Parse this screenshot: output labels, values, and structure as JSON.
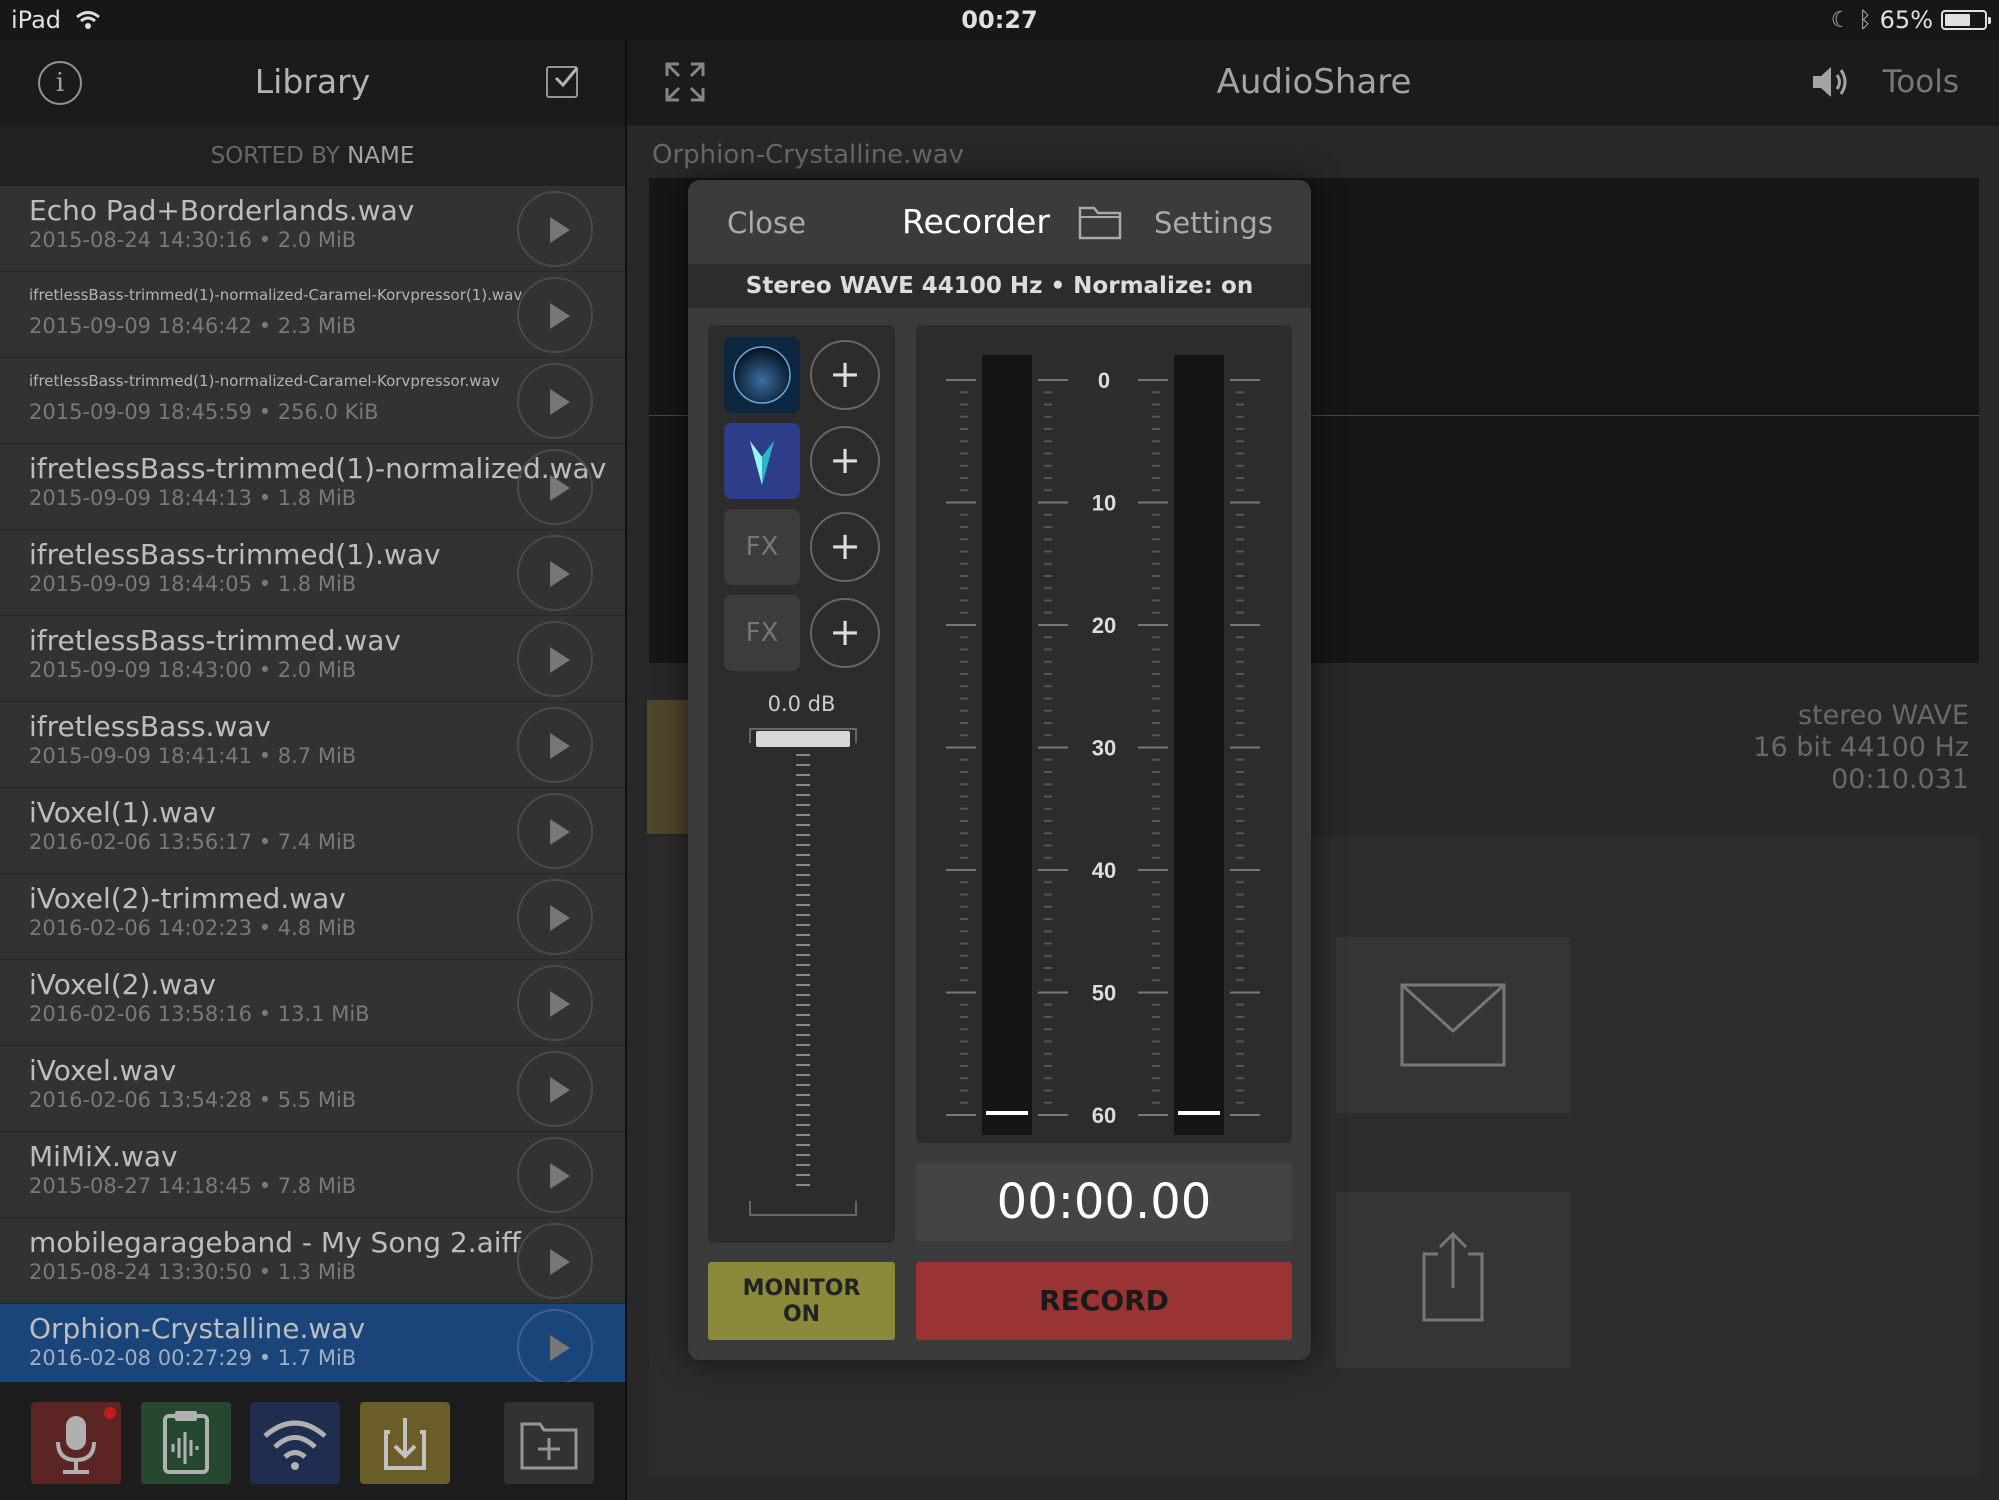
{
  "status": {
    "device": "iPad",
    "time": "00:27",
    "battery": "65%"
  },
  "library": {
    "title": "Library",
    "sort_prefix": "SORTED BY",
    "sort_key": "NAME",
    "files": [
      {
        "name": "Echo Pad+Borderlands.wav",
        "meta": "2015-08-24 14:30:16 • 2.0 MiB"
      },
      {
        "name": "ifretlessBass-trimmed(1)-normalized-Caramel-Korvpressor(1).wav",
        "meta": "2015-09-09 18:46:42 • 2.3 MiB"
      },
      {
        "name": "ifretlessBass-trimmed(1)-normalized-Caramel-Korvpressor.wav",
        "meta": "2015-09-09 18:45:59 • 256.0 KiB"
      },
      {
        "name": "ifretlessBass-trimmed(1)-normalized.wav",
        "meta": "2015-09-09 18:44:13 • 1.8 MiB"
      },
      {
        "name": "ifretlessBass-trimmed(1).wav",
        "meta": "2015-09-09 18:44:05 • 1.8 MiB"
      },
      {
        "name": "ifretlessBass-trimmed.wav",
        "meta": "2015-09-09 18:43:00 • 2.0 MiB"
      },
      {
        "name": "ifretlessBass.wav",
        "meta": "2015-09-09 18:41:41 • 8.7 MiB"
      },
      {
        "name": "iVoxel(1).wav",
        "meta": "2016-02-06 13:56:17 • 7.4 MiB"
      },
      {
        "name": "iVoxel(2)-trimmed.wav",
        "meta": "2016-02-06 14:02:23 • 4.8 MiB"
      },
      {
        "name": "iVoxel(2).wav",
        "meta": "2016-02-06 13:58:16 • 13.1 MiB"
      },
      {
        "name": "iVoxel.wav",
        "meta": "2016-02-06 13:54:28 • 5.5 MiB"
      },
      {
        "name": "MiMiX.wav",
        "meta": "2015-08-27 14:18:45 • 7.8 MiB"
      },
      {
        "name": "mobilegarageband - My Song 2.aiff",
        "meta": "2015-08-24 13:30:50 • 1.3 MiB"
      },
      {
        "name": "Orphion-Crystalline.wav",
        "meta": "2016-02-08 00:27:29 • 1.7 MiB"
      }
    ],
    "footer_icons": [
      "microphone-icon",
      "clipboard-waveform-icon",
      "wifi-icon",
      "download-icon",
      "new-folder-icon"
    ]
  },
  "main": {
    "title": "AudioShare",
    "tools_label": "Tools",
    "current_file": "Orphion-Crystalline.wav",
    "file_info": [
      "stereo WAVE",
      "16 bit 44100 Hz",
      "00:10.031"
    ]
  },
  "recorder": {
    "close_label": "Close",
    "title": "Recorder",
    "settings_label": "Settings",
    "format": "Stereo WAVE 44100 Hz • Normalize: on",
    "fx_slots": [
      "",
      "",
      "FX",
      "FX"
    ],
    "gain": "0.0 dB",
    "meter_scale": [
      "0",
      "10",
      "20",
      "30",
      "40",
      "50",
      "60"
    ],
    "time": "00:00.00",
    "monitor_label_1": "MONITOR",
    "monitor_label_2": "ON",
    "record_label": "RECORD"
  },
  "colors": {
    "selected_row": "#1d4f8c",
    "record": "#9a3434",
    "monitor": "#8a8a3a"
  }
}
